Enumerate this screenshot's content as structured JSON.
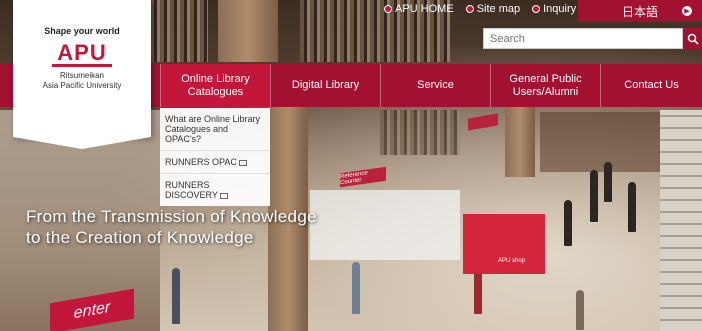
{
  "top_links": [
    {
      "label": "APU HOME"
    },
    {
      "label": "Site map"
    },
    {
      "label": "Inquiry"
    }
  ],
  "language_toggle": "日本語",
  "search": {
    "placeholder": "Search"
  },
  "logo": {
    "tagline": "Shape your world",
    "name": "APU",
    "university_line1": "Ritsumeikan",
    "university_line2": "Asia Pacific University"
  },
  "nav": {
    "items": [
      {
        "line1": "Online Library",
        "line2": "Catalogues"
      },
      {
        "line1": "Digital Library",
        "line2": ""
      },
      {
        "line1": "Service",
        "line2": ""
      },
      {
        "line1": "General Public",
        "line2": "Users/Alumni"
      },
      {
        "line1": "Contact Us",
        "line2": ""
      }
    ]
  },
  "dropdown": {
    "items": [
      {
        "label": "What are Online Library Catalogues and OPAC's?"
      },
      {
        "label": "RUNNERS OPAC"
      },
      {
        "label": "RUNNERS DISCOVERY"
      }
    ]
  },
  "headline": {
    "line1": "From the Transmission of Knowledge",
    "line2": "to the Creation of Knowledge"
  },
  "scene": {
    "sign": "Reference Counter",
    "booth": "APU shop",
    "banner": "enter"
  },
  "colors": {
    "brand": "#a31132",
    "accent": "#c2163a"
  }
}
